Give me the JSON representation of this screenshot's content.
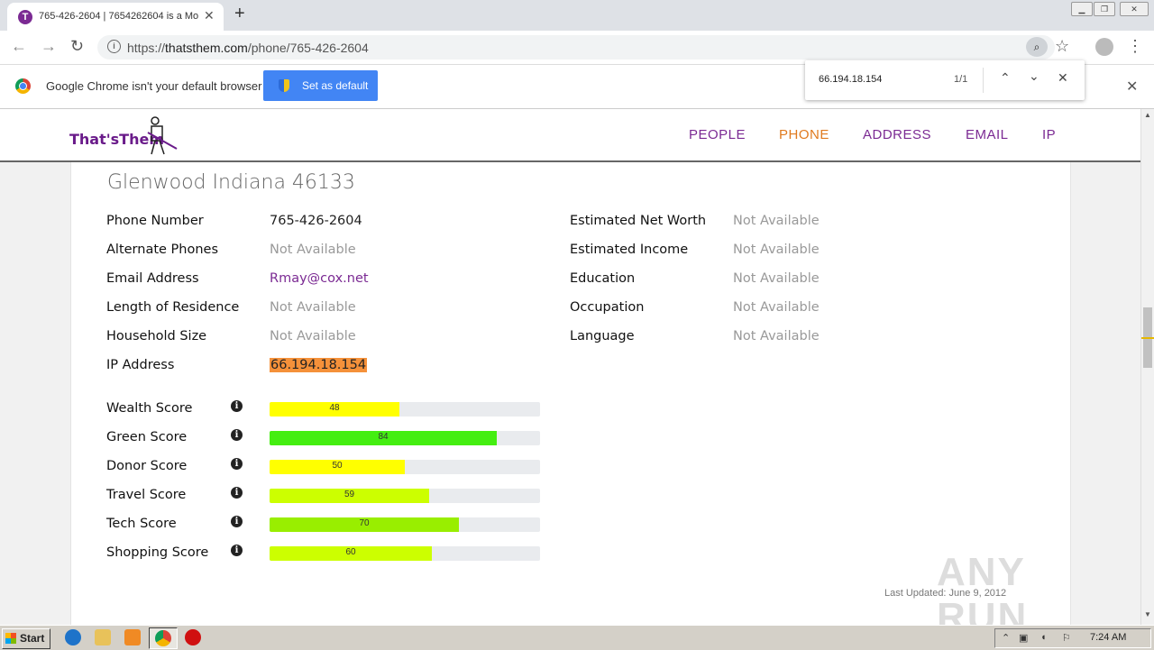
{
  "browser": {
    "tab_title": "765-426-2604 | 7654262604 is a Mo",
    "tab_favicon_letter": "T",
    "url_prefix": "https://",
    "url_host": "thatsthem.com",
    "url_path": "/phone/765-426-2604",
    "infobar_message": "Google Chrome isn't your default browser",
    "set_default_label": "Set as default",
    "find": {
      "query": "66.194.18.154",
      "count": "1/1"
    }
  },
  "site": {
    "logo_text": "That'sThem",
    "nav": [
      "PEOPLE",
      "PHONE",
      "ADDRESS",
      "EMAIL",
      "IP"
    ],
    "active_nav": "PHONE"
  },
  "record": {
    "location": "Glenwood Indiana 46133",
    "left_fields": [
      {
        "label": "Phone Number",
        "value": "765-426-2604"
      },
      {
        "label": "Alternate Phones",
        "value": "Not Available"
      },
      {
        "label": "Email Address",
        "value": "Rmay@cox.net"
      },
      {
        "label": "Length of Residence",
        "value": "Not Available"
      },
      {
        "label": "Household Size",
        "value": "Not Available"
      },
      {
        "label": "IP Address",
        "value": "66.194.18.154"
      }
    ],
    "right_fields": [
      {
        "label": "Estimated Net Worth",
        "value": "Not Available"
      },
      {
        "label": "Estimated Income",
        "value": "Not Available"
      },
      {
        "label": "Education",
        "value": "Not Available"
      },
      {
        "label": "Occupation",
        "value": "Not Available"
      },
      {
        "label": "Language",
        "value": "Not Available"
      }
    ],
    "scores": [
      {
        "label": "Wealth Score",
        "value": 48,
        "color": "#ffff00"
      },
      {
        "label": "Green Score",
        "value": 84,
        "color": "#44ee11"
      },
      {
        "label": "Donor Score",
        "value": 50,
        "color": "#ffff00"
      },
      {
        "label": "Travel Score",
        "value": 59,
        "color": "#ccff00"
      },
      {
        "label": "Tech Score",
        "value": 70,
        "color": "#99ee00"
      },
      {
        "label": "Shopping Score",
        "value": 60,
        "color": "#ccff00"
      }
    ],
    "last_updated": "Last Updated: June 9, 2012"
  },
  "watermark": "ANY RUN",
  "taskbar": {
    "start_label": "Start",
    "clock": "7:24 AM"
  }
}
